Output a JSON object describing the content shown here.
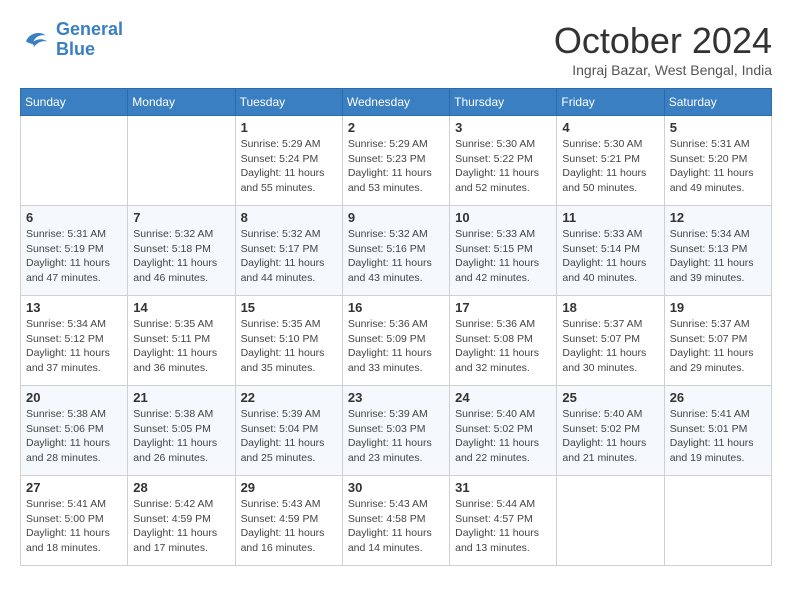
{
  "logo": {
    "line1": "General",
    "line2": "Blue"
  },
  "title": "October 2024",
  "location": "Ingraj Bazar, West Bengal, India",
  "days_header": [
    "Sunday",
    "Monday",
    "Tuesday",
    "Wednesday",
    "Thursday",
    "Friday",
    "Saturday"
  ],
  "weeks": [
    [
      {
        "day": "",
        "info": ""
      },
      {
        "day": "",
        "info": ""
      },
      {
        "day": "1",
        "info": "Sunrise: 5:29 AM\nSunset: 5:24 PM\nDaylight: 11 hours and 55 minutes."
      },
      {
        "day": "2",
        "info": "Sunrise: 5:29 AM\nSunset: 5:23 PM\nDaylight: 11 hours and 53 minutes."
      },
      {
        "day": "3",
        "info": "Sunrise: 5:30 AM\nSunset: 5:22 PM\nDaylight: 11 hours and 52 minutes."
      },
      {
        "day": "4",
        "info": "Sunrise: 5:30 AM\nSunset: 5:21 PM\nDaylight: 11 hours and 50 minutes."
      },
      {
        "day": "5",
        "info": "Sunrise: 5:31 AM\nSunset: 5:20 PM\nDaylight: 11 hours and 49 minutes."
      }
    ],
    [
      {
        "day": "6",
        "info": "Sunrise: 5:31 AM\nSunset: 5:19 PM\nDaylight: 11 hours and 47 minutes."
      },
      {
        "day": "7",
        "info": "Sunrise: 5:32 AM\nSunset: 5:18 PM\nDaylight: 11 hours and 46 minutes."
      },
      {
        "day": "8",
        "info": "Sunrise: 5:32 AM\nSunset: 5:17 PM\nDaylight: 11 hours and 44 minutes."
      },
      {
        "day": "9",
        "info": "Sunrise: 5:32 AM\nSunset: 5:16 PM\nDaylight: 11 hours and 43 minutes."
      },
      {
        "day": "10",
        "info": "Sunrise: 5:33 AM\nSunset: 5:15 PM\nDaylight: 11 hours and 42 minutes."
      },
      {
        "day": "11",
        "info": "Sunrise: 5:33 AM\nSunset: 5:14 PM\nDaylight: 11 hours and 40 minutes."
      },
      {
        "day": "12",
        "info": "Sunrise: 5:34 AM\nSunset: 5:13 PM\nDaylight: 11 hours and 39 minutes."
      }
    ],
    [
      {
        "day": "13",
        "info": "Sunrise: 5:34 AM\nSunset: 5:12 PM\nDaylight: 11 hours and 37 minutes."
      },
      {
        "day": "14",
        "info": "Sunrise: 5:35 AM\nSunset: 5:11 PM\nDaylight: 11 hours and 36 minutes."
      },
      {
        "day": "15",
        "info": "Sunrise: 5:35 AM\nSunset: 5:10 PM\nDaylight: 11 hours and 35 minutes."
      },
      {
        "day": "16",
        "info": "Sunrise: 5:36 AM\nSunset: 5:09 PM\nDaylight: 11 hours and 33 minutes."
      },
      {
        "day": "17",
        "info": "Sunrise: 5:36 AM\nSunset: 5:08 PM\nDaylight: 11 hours and 32 minutes."
      },
      {
        "day": "18",
        "info": "Sunrise: 5:37 AM\nSunset: 5:07 PM\nDaylight: 11 hours and 30 minutes."
      },
      {
        "day": "19",
        "info": "Sunrise: 5:37 AM\nSunset: 5:07 PM\nDaylight: 11 hours and 29 minutes."
      }
    ],
    [
      {
        "day": "20",
        "info": "Sunrise: 5:38 AM\nSunset: 5:06 PM\nDaylight: 11 hours and 28 minutes."
      },
      {
        "day": "21",
        "info": "Sunrise: 5:38 AM\nSunset: 5:05 PM\nDaylight: 11 hours and 26 minutes."
      },
      {
        "day": "22",
        "info": "Sunrise: 5:39 AM\nSunset: 5:04 PM\nDaylight: 11 hours and 25 minutes."
      },
      {
        "day": "23",
        "info": "Sunrise: 5:39 AM\nSunset: 5:03 PM\nDaylight: 11 hours and 23 minutes."
      },
      {
        "day": "24",
        "info": "Sunrise: 5:40 AM\nSunset: 5:02 PM\nDaylight: 11 hours and 22 minutes."
      },
      {
        "day": "25",
        "info": "Sunrise: 5:40 AM\nSunset: 5:02 PM\nDaylight: 11 hours and 21 minutes."
      },
      {
        "day": "26",
        "info": "Sunrise: 5:41 AM\nSunset: 5:01 PM\nDaylight: 11 hours and 19 minutes."
      }
    ],
    [
      {
        "day": "27",
        "info": "Sunrise: 5:41 AM\nSunset: 5:00 PM\nDaylight: 11 hours and 18 minutes."
      },
      {
        "day": "28",
        "info": "Sunrise: 5:42 AM\nSunset: 4:59 PM\nDaylight: 11 hours and 17 minutes."
      },
      {
        "day": "29",
        "info": "Sunrise: 5:43 AM\nSunset: 4:59 PM\nDaylight: 11 hours and 16 minutes."
      },
      {
        "day": "30",
        "info": "Sunrise: 5:43 AM\nSunset: 4:58 PM\nDaylight: 11 hours and 14 minutes."
      },
      {
        "day": "31",
        "info": "Sunrise: 5:44 AM\nSunset: 4:57 PM\nDaylight: 11 hours and 13 minutes."
      },
      {
        "day": "",
        "info": ""
      },
      {
        "day": "",
        "info": ""
      }
    ]
  ]
}
